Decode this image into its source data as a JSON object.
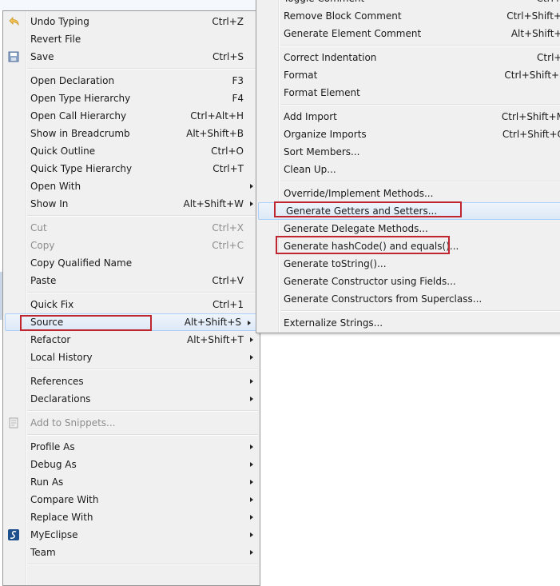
{
  "main_menu": {
    "items": [
      {
        "label": "Undo Typing",
        "shortcut": "Ctrl+Z",
        "icon": "undo-icon"
      },
      {
        "label": "Revert File"
      },
      {
        "label": "Save",
        "shortcut": "Ctrl+S",
        "icon": "save-icon"
      },
      {
        "sep": true
      },
      {
        "label": "Open Declaration",
        "shortcut": "F3"
      },
      {
        "label": "Open Type Hierarchy",
        "shortcut": "F4"
      },
      {
        "label": "Open Call Hierarchy",
        "shortcut": "Ctrl+Alt+H"
      },
      {
        "label": "Show in Breadcrumb",
        "shortcut": "Alt+Shift+B"
      },
      {
        "label": "Quick Outline",
        "shortcut": "Ctrl+O"
      },
      {
        "label": "Quick Type Hierarchy",
        "shortcut": "Ctrl+T"
      },
      {
        "label": "Open With",
        "submenu": true
      },
      {
        "label": "Show In",
        "shortcut": "Alt+Shift+W",
        "submenu": true
      },
      {
        "sep": true
      },
      {
        "label": "Cut",
        "shortcut": "Ctrl+X",
        "disabled": true
      },
      {
        "label": "Copy",
        "shortcut": "Ctrl+C",
        "disabled": true
      },
      {
        "label": "Copy Qualified Name"
      },
      {
        "label": "Paste",
        "shortcut": "Ctrl+V"
      },
      {
        "sep": true
      },
      {
        "label": "Quick Fix",
        "shortcut": "Ctrl+1"
      },
      {
        "label": "Source",
        "shortcut": "Alt+Shift+S",
        "submenu": true,
        "highlighted": true
      },
      {
        "label": "Refactor",
        "shortcut": "Alt+Shift+T",
        "submenu": true
      },
      {
        "label": "Local History",
        "submenu": true
      },
      {
        "sep": true
      },
      {
        "label": "References",
        "submenu": true
      },
      {
        "label": "Declarations",
        "submenu": true
      },
      {
        "sep": true
      },
      {
        "label": "Add to Snippets...",
        "disabled": true,
        "icon": "snippets-icon"
      },
      {
        "sep": true
      },
      {
        "label": "Profile As",
        "submenu": true
      },
      {
        "label": "Debug As",
        "submenu": true
      },
      {
        "label": "Run As",
        "submenu": true
      },
      {
        "label": "Compare With",
        "submenu": true
      },
      {
        "label": "Replace With",
        "submenu": true
      },
      {
        "label": "MyEclipse",
        "submenu": true,
        "icon": "myeclipse-icon"
      },
      {
        "label": "Team",
        "submenu": true
      },
      {
        "sep": true
      }
    ]
  },
  "source_submenu": {
    "items": [
      {
        "label": "Toggle Comment",
        "shortcut": "Ctrl+/"
      },
      {
        "label": "Remove Block Comment",
        "shortcut": "Ctrl+Shift+\\"
      },
      {
        "label": "Generate Element Comment",
        "shortcut": "Alt+Shift+J"
      },
      {
        "sep": true
      },
      {
        "label": "Correct Indentation",
        "shortcut": "Ctrl+I"
      },
      {
        "label": "Format",
        "shortcut": "Ctrl+Shift+F"
      },
      {
        "label": "Format Element"
      },
      {
        "sep": true
      },
      {
        "label": "Add Import",
        "shortcut": "Ctrl+Shift+M"
      },
      {
        "label": "Organize Imports",
        "shortcut": "Ctrl+Shift+O"
      },
      {
        "label": "Sort Members..."
      },
      {
        "label": "Clean Up..."
      },
      {
        "sep": true
      },
      {
        "label": "Override/Implement Methods..."
      },
      {
        "label": "Generate Getters and Setters...",
        "highlighted": true
      },
      {
        "label": "Generate Delegate Methods..."
      },
      {
        "label": "Generate hashCode() and equals()..."
      },
      {
        "label": "Generate toString()..."
      },
      {
        "label": "Generate Constructor using Fields..."
      },
      {
        "label": "Generate Constructors from Superclass..."
      },
      {
        "sep": true
      },
      {
        "label": "Externalize Strings..."
      }
    ]
  },
  "colors": {
    "annotation_red": "#c0262f",
    "highlight": "#dde9f7",
    "menu_bg": "#f0f0f0"
  }
}
